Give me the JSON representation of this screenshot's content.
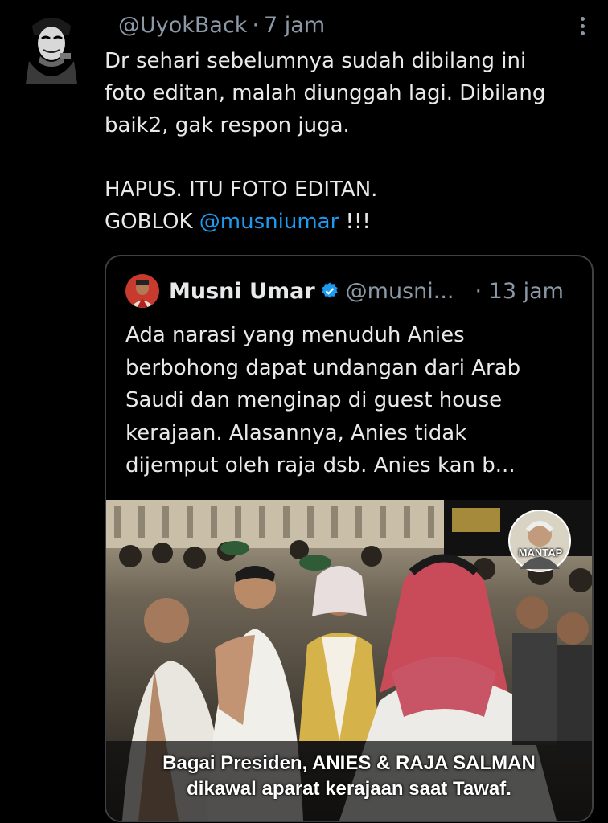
{
  "tweet": {
    "handle": "@UyokBack",
    "separator": "·",
    "time": "7 jam",
    "lines": [
      "Dr sehari sebelumnya sudah dibilang ini",
      "foto editan, malah diunggah lagi. Dibilang",
      "baik2, gak respon juga."
    ],
    "line4": "HAPUS. ITU FOTO EDITAN.",
    "line5_prefix": "GOBLOK ",
    "mention": "@musniumar",
    "line5_suffix": " !!!"
  },
  "quote": {
    "name": "Musni Umar",
    "handle": "@musni...",
    "time": "· 13 jam",
    "lines": [
      "Ada narasi yang menuduh Anies",
      "berbohong  dapat undangan dari Arab",
      "Saudi dan menginap di guest house",
      "kerajaan.  Alasannya,  Anies tidak",
      "dijemput oleh raja dsb.  Anies kan b..."
    ],
    "image": {
      "badge": "MANTAP",
      "caption_line1": "Bagai Presiden, ANIES & RAJA SALMAN",
      "caption_line2": "dikawal aparat kerajaan saat Tawaf."
    }
  },
  "colors": {
    "background": "#000000",
    "text": "#e7e9ea",
    "muted": "#8b98a5",
    "link": "#1d9bf0",
    "border": "#3e4144"
  }
}
